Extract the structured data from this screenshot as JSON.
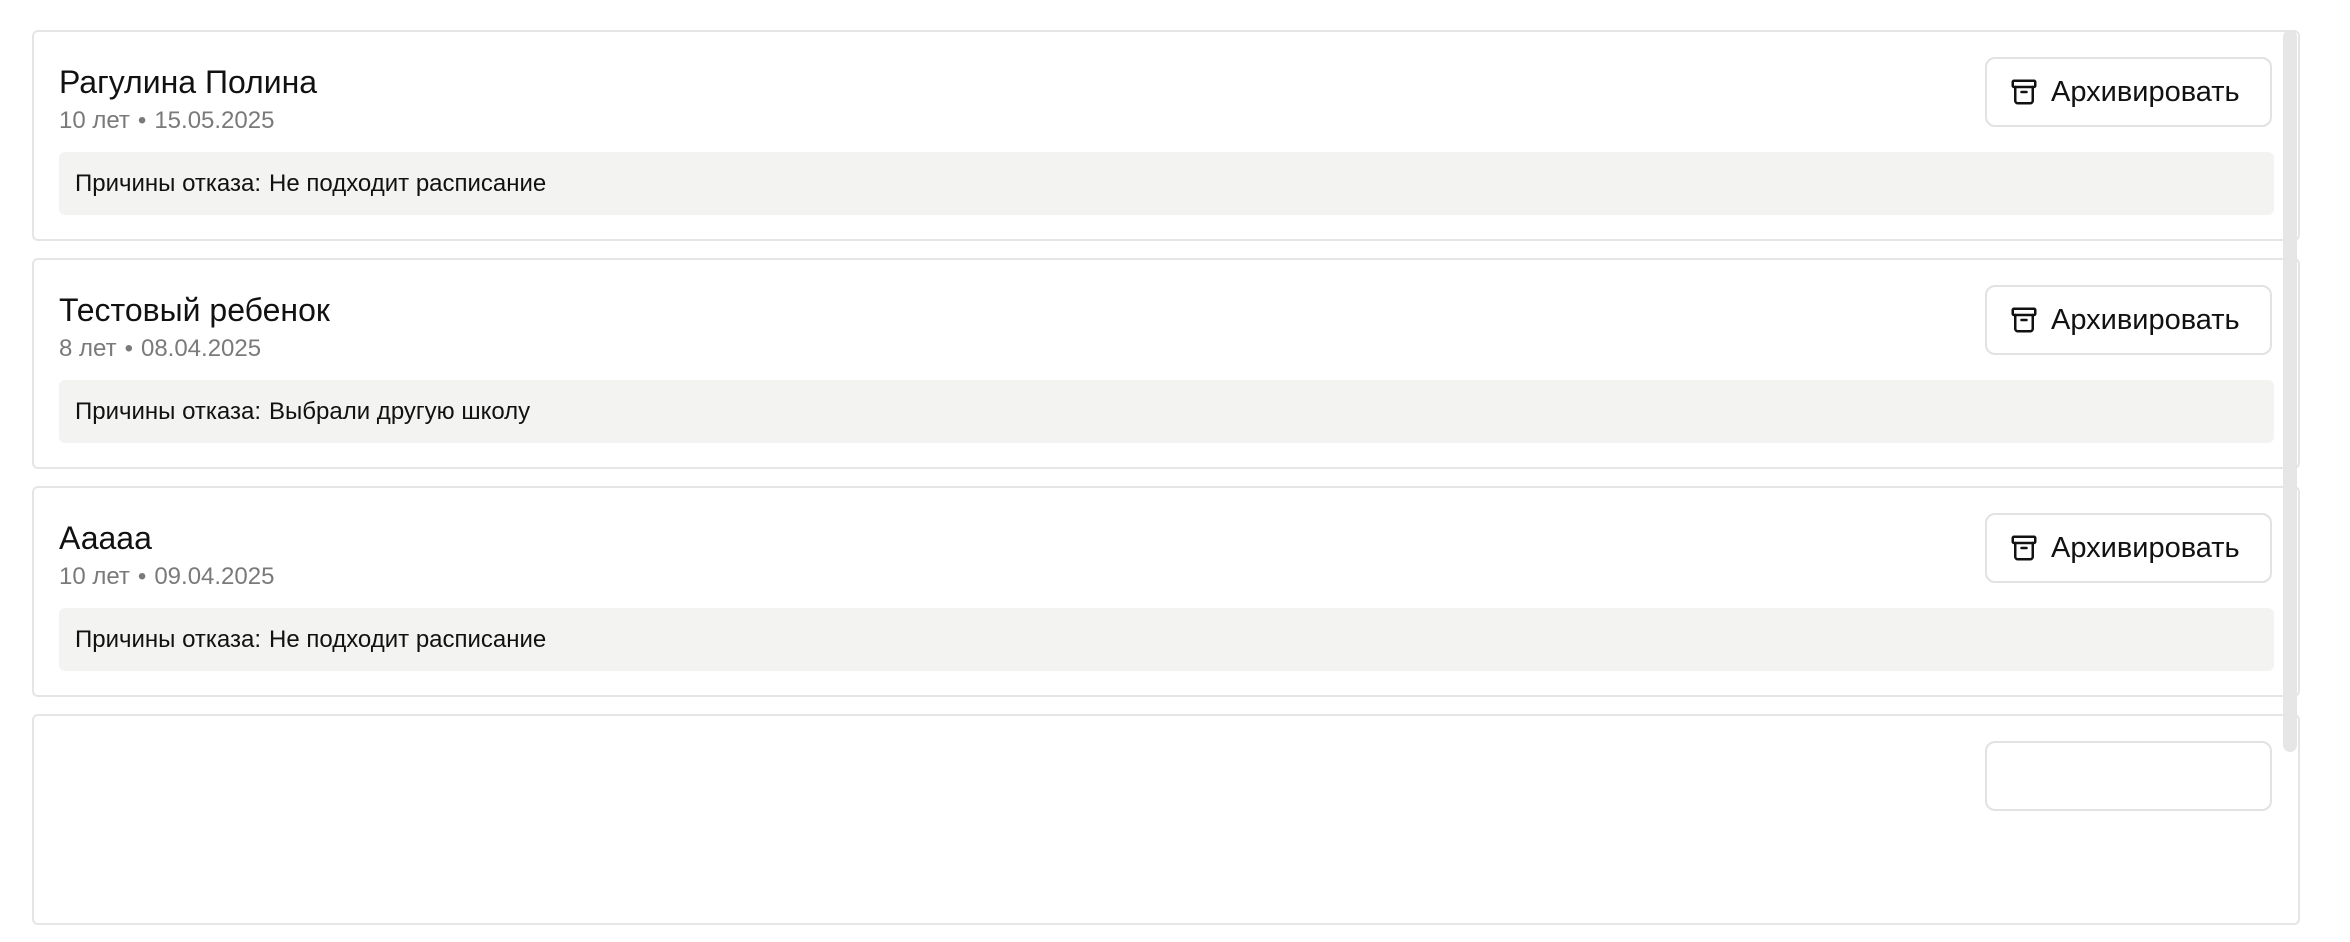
{
  "archive_label": "Архивировать",
  "reason_prefix": "Причины отказа:",
  "cards": [
    {
      "name": "Рагулина Полина",
      "age": "10 лет",
      "separator": "•",
      "date": "15.05.2025",
      "reason": "Не подходит расписание"
    },
    {
      "name": "Тестовый ребенок",
      "age": "8 лет",
      "separator": "•",
      "date": "08.04.2025",
      "reason": "Выбрали другую школу"
    },
    {
      "name": "Ааааа",
      "age": "10 лет",
      "separator": "•",
      "date": "09.04.2025",
      "reason": "Не подходит расписание"
    }
  ],
  "icons": {
    "archive": "archive-box-icon"
  },
  "colors": {
    "card_border": "#e5e5e5",
    "reason_background": "#f3f3f2",
    "meta_text": "#7a7a7a",
    "scrollbar": "#e6e6e6"
  }
}
